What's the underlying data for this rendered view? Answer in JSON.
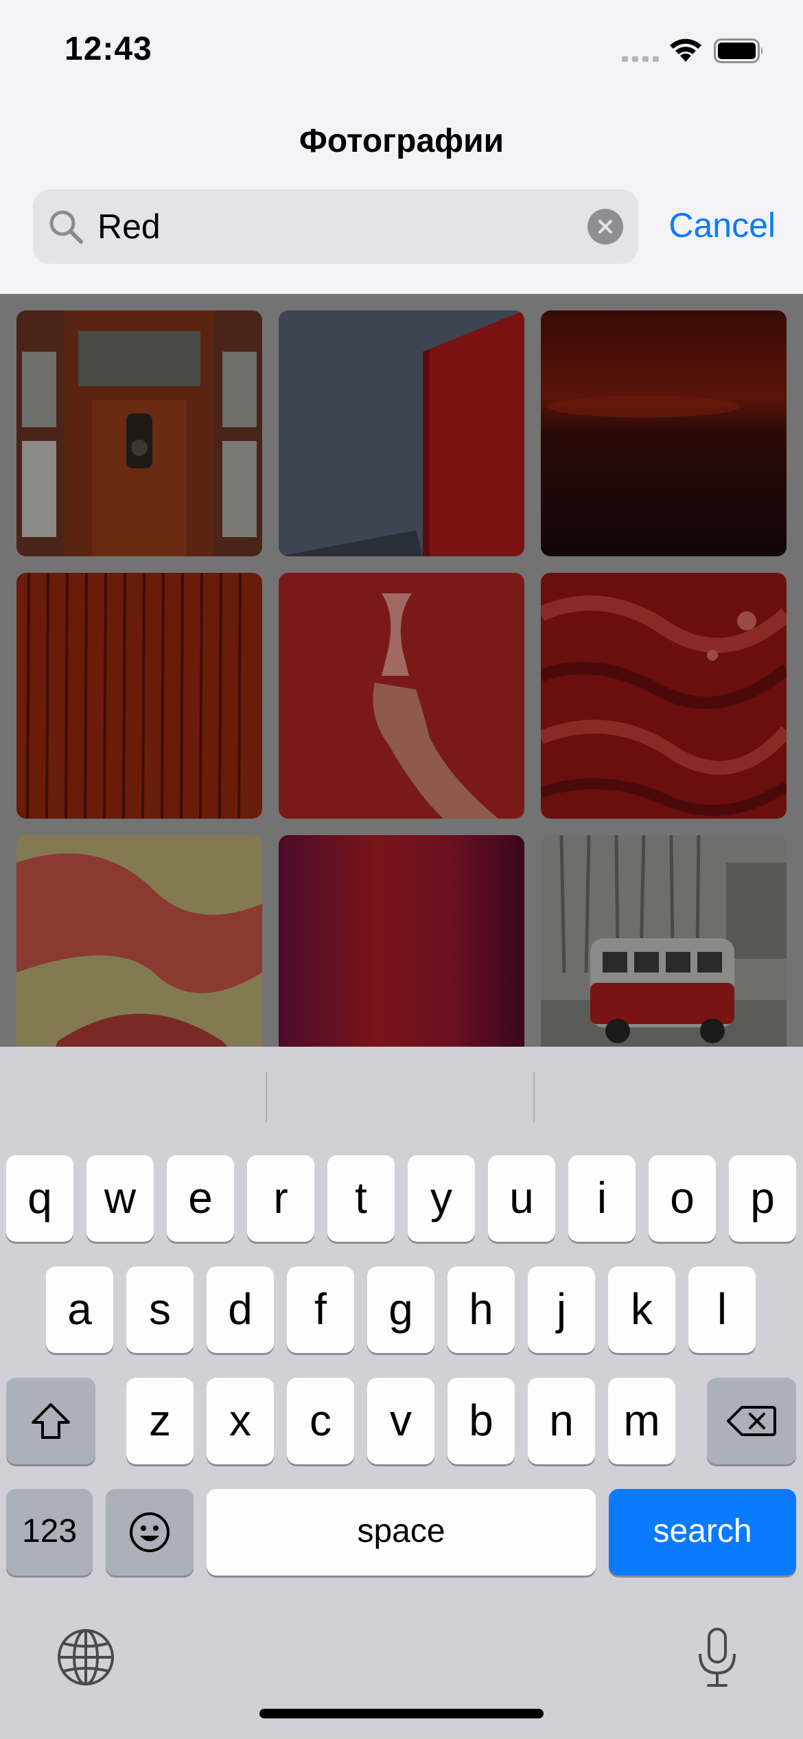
{
  "status_bar": {
    "time": "12:43"
  },
  "header": {
    "title": "Фотографии",
    "search_value": "Red",
    "cancel_label": "Cancel"
  },
  "photos": [
    "red-telephone-booth-interior",
    "red-wall-against-sky",
    "dark-red-sunset",
    "red-wood-planks",
    "hand-holding-cup-on-red",
    "red-marbled-texture",
    "yellow-red-abstract",
    "magenta-red-gradient",
    "red-vw-bus"
  ],
  "keyboard": {
    "row1": [
      "q",
      "w",
      "e",
      "r",
      "t",
      "y",
      "u",
      "i",
      "o",
      "p"
    ],
    "row2": [
      "a",
      "s",
      "d",
      "f",
      "g",
      "h",
      "j",
      "k",
      "l"
    ],
    "row3": [
      "z",
      "x",
      "c",
      "v",
      "b",
      "n",
      "m"
    ],
    "numbers_label": "123",
    "space_label": "space",
    "search_label": "search",
    "icons": {
      "shift": "shift-icon",
      "delete": "delete-icon",
      "emoji": "emoji-icon",
      "globe": "globe-icon",
      "mic": "microphone-icon"
    }
  },
  "colors": {
    "accent": "#0a7aff",
    "keyboard_bg": "#d0d0d6"
  }
}
